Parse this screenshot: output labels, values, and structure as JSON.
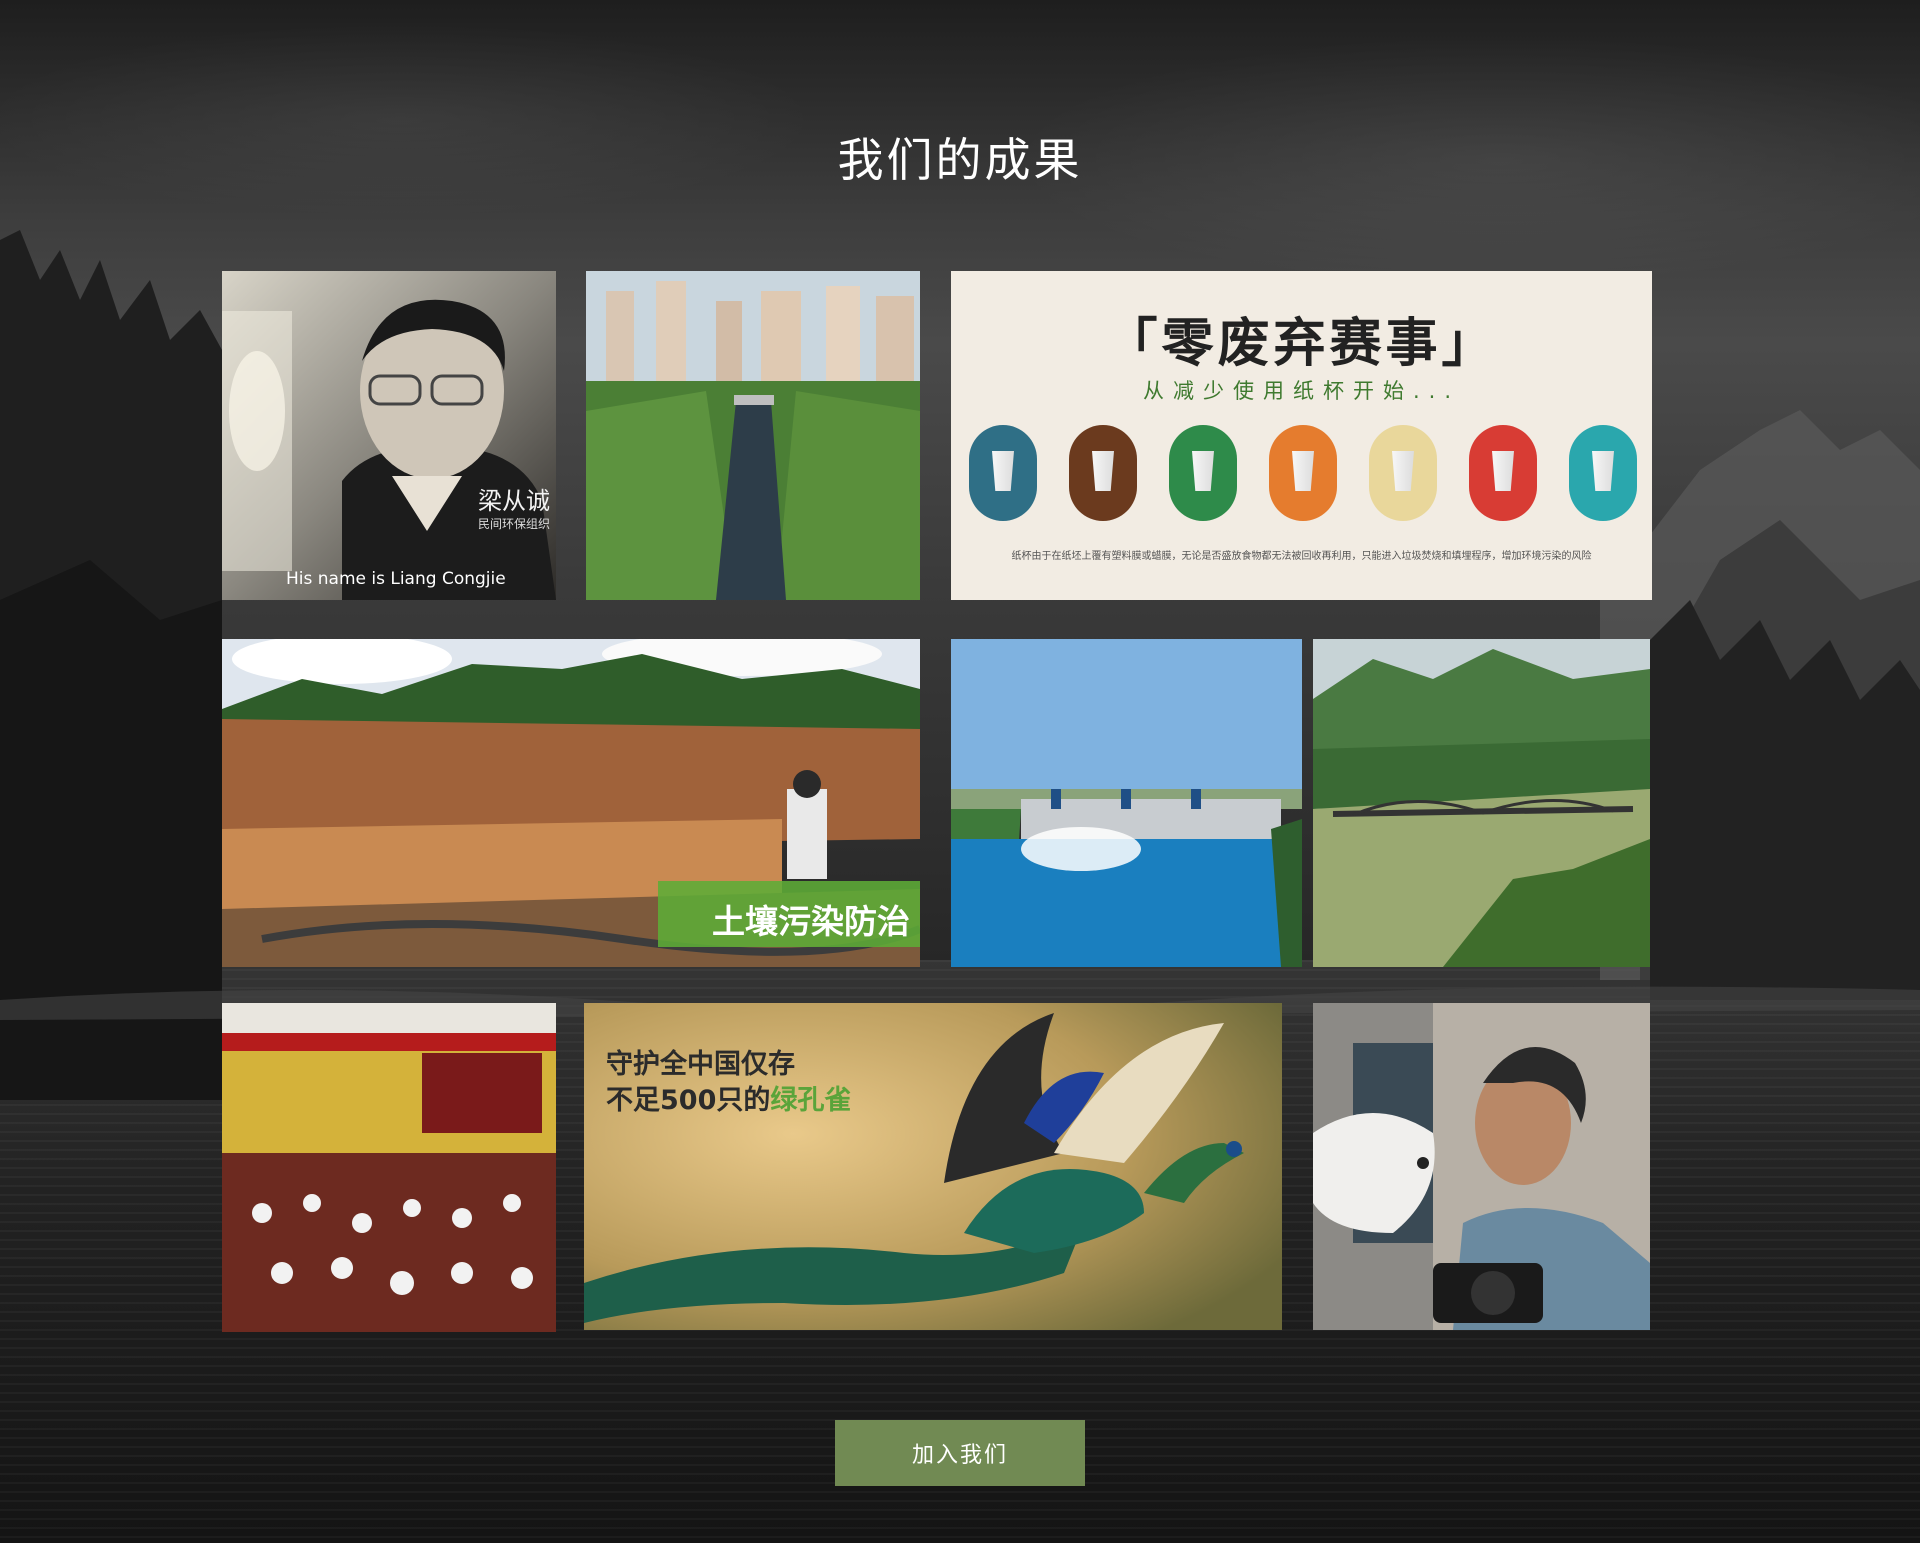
{
  "section": {
    "title": "我们的成果"
  },
  "tiles": {
    "portrait": {
      "name": "梁从诚",
      "org": "民间环保组织",
      "caption": "His name is Liang Congjie"
    },
    "poster": {
      "title": "「零废弃赛事」",
      "subtitle": "从减少使用纸杯开始...",
      "note": "纸杯由于在纸坯上覆有塑料膜或蜡膜，无论是否盛放食物都无法被回收再利用，只能进入垃圾焚烧和填埋程序，增加环境污染的风险",
      "cup_colors": [
        "#2f6f86",
        "#6b3a1e",
        "#2e8b4a",
        "#e57c2e",
        "#e9d79b",
        "#d83c34",
        "#2aa7ad"
      ]
    },
    "soil": {
      "tag": "土壤污染防治"
    },
    "peacock": {
      "line1": "守护全中国仅存",
      "line2_prefix": "不足500只的",
      "line2_highlight": "绿孔雀"
    }
  },
  "cta": {
    "label": "加入我们"
  }
}
